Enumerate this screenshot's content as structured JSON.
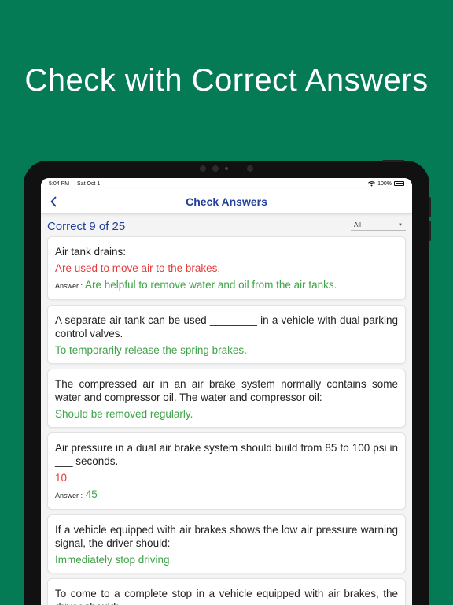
{
  "headline": "Check with Correct Answers",
  "status": {
    "time": "5:04 PM",
    "date": "Sat Oct 1",
    "battery": "100%"
  },
  "nav": {
    "back_icon": "chevron-left-icon",
    "title": "Check Answers"
  },
  "summary": {
    "correct_text": "Correct 9 of 25",
    "filter_value": "All"
  },
  "cards": [
    {
      "question": "Air tank drains:",
      "user_answer": "Are used to move air to the brakes.",
      "user_correct": false,
      "answer_label": "Answer :",
      "correct_answer": "Are helpful to remove water and oil from the air tanks."
    },
    {
      "question": "A separate air tank can be used ________ in a vehicle with dual parking control valves.",
      "user_answer": "To temporarily release the spring brakes.",
      "user_correct": true
    },
    {
      "question": "The compressed air in an air brake system normally contains some water and compressor oil. The water and compressor oil:",
      "user_answer": "Should be removed regularly.",
      "user_correct": true
    },
    {
      "question": "Air pressure in a dual air brake system should build from 85 to 100 psi in ___ seconds.",
      "user_answer": "10",
      "user_correct": false,
      "answer_label": "Answer :",
      "correct_answer": "45"
    },
    {
      "question": "If a vehicle equipped with air brakes shows the low air pressure warning signal, the driver should:",
      "user_answer": "Immediately stop driving.",
      "user_correct": true
    },
    {
      "question": "To come to a complete stop in a vehicle equipped with air brakes, the driver should:"
    }
  ],
  "colors": {
    "background": "#047a55",
    "accent": "#1f3f9a",
    "wrong": "#e83a3a",
    "right": "#3ea346"
  }
}
